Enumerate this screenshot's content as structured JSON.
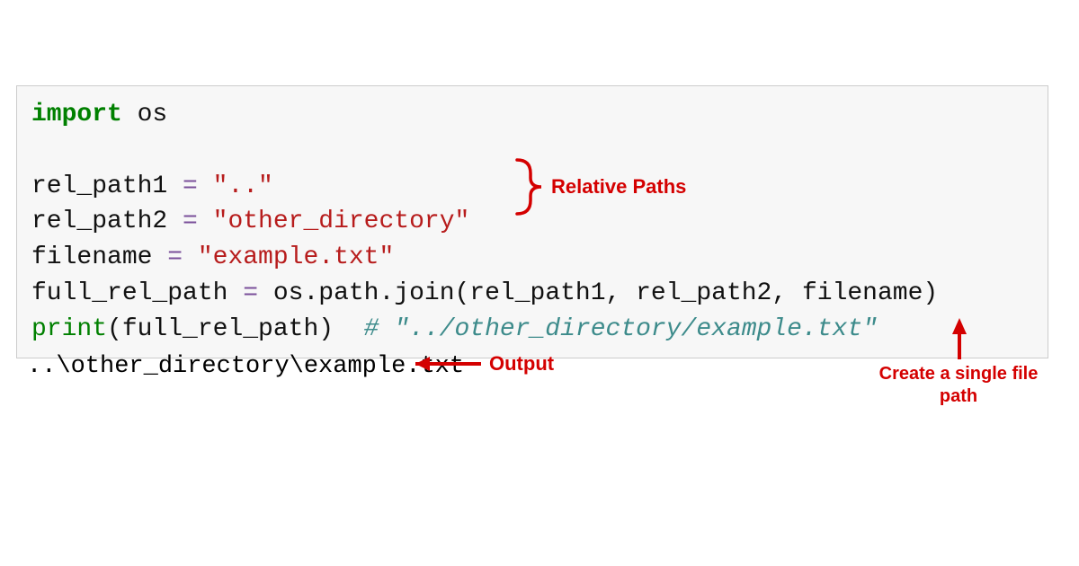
{
  "code": {
    "import_kw": "import",
    "import_mod": " os",
    "line2_var": "rel_path1 ",
    "line2_op": "=",
    "line2_str": " \"..\"",
    "line3_var": "rel_path2 ",
    "line3_op": "=",
    "line3_str": " \"other_directory\"",
    "line4_var": "filename ",
    "line4_op": "=",
    "line4_str": " \"example.txt\"",
    "line5_var": "full_rel_path ",
    "line5_op": "=",
    "line5_rest": " os.path.join(rel_path1, rel_path2, filename)",
    "line6_fn": "print",
    "line6_args": "(full_rel_path)  ",
    "line6_comment": "# \"../other_directory/example.txt\""
  },
  "output": "..\\other_directory\\example.txt",
  "annotations": {
    "relative_paths": "Relative Paths",
    "output": "Output",
    "single_file_path": "Create a single file\npath"
  },
  "colors": {
    "keyword": "#008000",
    "string": "#b71c1c",
    "operator": "#7a4f9a",
    "comment": "#3d8b8b",
    "annotation": "#d40000",
    "code_bg": "#f7f7f7",
    "code_border": "#cccccc"
  }
}
